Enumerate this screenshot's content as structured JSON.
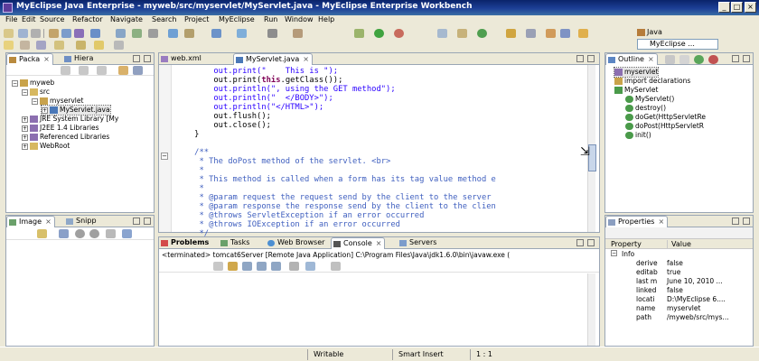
{
  "window": {
    "title": "MyEclipse Java Enterprise - myweb/src/myservlet/MyServlet.java - MyEclipse Enterprise Workbench",
    "minimize": "_",
    "maximize": "□",
    "close": "×"
  },
  "menu": [
    "File",
    "Edit",
    "Source",
    "Refactor",
    "Navigate",
    "Search",
    "Project",
    "MyEclipse",
    "Run",
    "Window",
    "Help"
  ],
  "perspectives": {
    "java": "Java",
    "myeclipse": "MyEclipse ..."
  },
  "package_explorer": {
    "tabs": [
      "Packa",
      "Hiera"
    ],
    "tree": [
      {
        "label": "myweb",
        "level": 0,
        "expanded": true
      },
      {
        "label": "src",
        "level": 1,
        "expanded": true
      },
      {
        "label": "myservlet",
        "level": 2,
        "expanded": true
      },
      {
        "label": "MyServlet.java",
        "level": 3,
        "expanded": false
      },
      {
        "label": "JRE System Library [My",
        "level": 1,
        "expanded": false
      },
      {
        "label": "J2EE 1.4 Libraries",
        "level": 1,
        "expanded": false
      },
      {
        "label": "Referenced Libraries",
        "level": 1,
        "expanded": false
      },
      {
        "label": "WebRoot",
        "level": 1,
        "expanded": false
      }
    ]
  },
  "image_panel": {
    "tabs": [
      "Image",
      "Snipp"
    ]
  },
  "editor": {
    "tabs": [
      "web.xml",
      "MyServlet.java"
    ],
    "lines": [
      [
        {
          "t": "        out.print(\"    This is \");",
          "c": "str"
        }
      ],
      [
        {
          "t": "        out.print(",
          "c": ""
        },
        {
          "t": "this",
          "c": "kw"
        },
        {
          "t": ".getClass());",
          "c": ""
        }
      ],
      [
        {
          "t": "        out.println(\", using the GET method\");",
          "c": "str"
        }
      ],
      [
        {
          "t": "        out.println(\"  </BODY>\");",
          "c": "str"
        }
      ],
      [
        {
          "t": "        out.println(\"</HTML>\");",
          "c": "str"
        }
      ],
      [
        {
          "t": "        out.flush();",
          "c": ""
        }
      ],
      [
        {
          "t": "        out.close();",
          "c": ""
        }
      ],
      [
        {
          "t": "    }",
          "c": ""
        }
      ],
      [
        {
          "t": "",
          "c": ""
        }
      ],
      [
        {
          "t": "    /**",
          "c": "jd"
        }
      ],
      [
        {
          "t": "     * The doPost method of the servlet. <br>",
          "c": "jd"
        }
      ],
      [
        {
          "t": "     *",
          "c": "jd"
        }
      ],
      [
        {
          "t": "     * This method is called when a form has its tag value method e",
          "c": "jd"
        }
      ],
      [
        {
          "t": "     *",
          "c": "jd"
        }
      ],
      [
        {
          "t": "     * @param request the request send by the client to the server",
          "c": "jd"
        }
      ],
      [
        {
          "t": "     * @param response the response send by the client to the clien",
          "c": "jd"
        }
      ],
      [
        {
          "t": "     * @throws ServletException if an error occurred",
          "c": "jd"
        }
      ],
      [
        {
          "t": "     * @throws IOException if an error occurred",
          "c": "jd"
        }
      ],
      [
        {
          "t": "     */",
          "c": "jd"
        }
      ]
    ]
  },
  "outline": {
    "tab": "Outline",
    "items": [
      {
        "label": "myservlet",
        "level": 0
      },
      {
        "label": "import declarations",
        "level": 0
      },
      {
        "label": "MyServlet",
        "level": 0
      },
      {
        "label": "MyServlet()",
        "level": 1
      },
      {
        "label": "destroy()",
        "level": 1
      },
      {
        "label": "doGet(HttpServletRe",
        "level": 1
      },
      {
        "label": "doPost(HttpServletR",
        "level": 1
      },
      {
        "label": "init()",
        "level": 1
      }
    ]
  },
  "console": {
    "tabs": [
      "Problems",
      "Tasks",
      "Web Browser",
      "Console",
      "Servers"
    ],
    "header": "<terminated> tomcat6Server [Remote Java Application] C:\\Program Files\\Java\\jdk1.6.0\\bin\\javaw.exe ("
  },
  "properties": {
    "tab": "Properties",
    "col_property": "Property",
    "col_value": "Value",
    "group": "Info",
    "rows": [
      {
        "k": "derive",
        "v": "false"
      },
      {
        "k": "editab",
        "v": "true"
      },
      {
        "k": "last m",
        "v": "June 10, 2010 ..."
      },
      {
        "k": "linked",
        "v": "false"
      },
      {
        "k": "locati",
        "v": "D:\\MyEclipse 6...."
      },
      {
        "k": "name",
        "v": "myservlet"
      },
      {
        "k": "path",
        "v": "/myweb/src/mys..."
      }
    ]
  },
  "status": {
    "writable": "Writable",
    "insert": "Smart Insert",
    "position": "1 : 1"
  },
  "colors": {
    "titlebar": "#0a246a",
    "keyword": "#7f0055",
    "string": "#2a00ff",
    "javadoc": "#3f5fbf"
  }
}
